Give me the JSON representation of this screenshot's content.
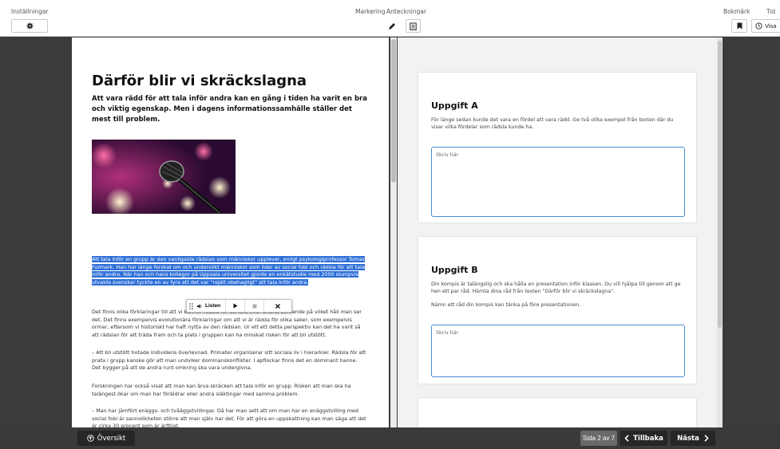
{
  "topbar": {
    "settings_label": "Inställningar",
    "markering_label": "Markering",
    "anteckningar_label": "Anteckningar",
    "bokmark_label": "Bokmärk",
    "tid_label": "Tid",
    "tid_button_label": "Visa"
  },
  "article": {
    "title": "Därför blir vi skräckslagna",
    "lead": "Att vara rädd för att tala inför andra kan en gång i tiden ha varit en bra och viktig egenskap. Men i dagens informationssamhälle ställer det mest till problem.",
    "p1": "Att tala inför en grupp är den vanligaste rädslan som människor upplever, enligt psykologiprofessor Tomas Furmark. Han har länge forskat om och undersökt människor som lider av social fobi och rädsla för att tala inför andra. När han och hans kollegor på Uppsala universitet gjorde en enkätstudie med 2000 slumpvis utvalda svenskar tyckte en av fyra att det var \"rejält obehagligt\" att tala inför andra.",
    "p2": "Det finns olika förklaringar till att vi känner rädsla för att tala inför andra, beroende på vilket håll man ser det. Det finns exempelvis evolutionära förklaringar om att vi är rädda för olika saker, som exempelvis ormar, eftersom vi historiskt har haft nytta av den rädslan. Ur ett ett detta perspektiv kan det ha varit så att rädslan för att träda fram och ta plats i gruppen kan ha minskat risken för att bli utstött.",
    "p3": "– Att bli utstött hotade individens överlevnad. Primater organiserar sitt sociala liv i hierarkier. Rädsla för att prata i grupp kanske gör att man undviker dominanskonflikter. I apflockar finns det en dominant hanne. Det bygger på att de andra runt omkring ska vara undergivna.",
    "p4": "Forskningen har också visat att man kan ärva skräcken att tala inför en grupp. Risken att man ska ha talängest ökar om man har föräldrar eller andra släktingar med samma problem.",
    "p5": "– Man har jämfört enäggs- och tvåäggstvillingar. Då har man sett att om man har en enäggstvilling med social fobi är sannolikheten större att man själv har det. För att göra en uppskattning kan man säga att det är cirka 30 procent som är ärftligt."
  },
  "listen": {
    "label": "Listen"
  },
  "tasks": [
    {
      "title": "Uppgift A",
      "text": "För länge sedan kunde det vara en fördel att vara rädd. Ge två olika exempel från texten där du visar vilka fördelar som rädsla kunde ha.",
      "placeholder": "Skriv här"
    },
    {
      "title": "Uppgift B",
      "text": "Din kompis är talängslig och ska hålla en presentation inför klassen. Du vill hjälpa till genom att ge hen ett par råd. Hämta dina råd från texten \"Därför blir vi skräckslagna\".",
      "text2": "Nämn ett råd din kompis kan tänka på före presentationen.",
      "placeholder": "Skriv här"
    }
  ],
  "bottom": {
    "overview_label": "Översikt",
    "page_indicator": "Sida 2 av 7",
    "back_label": "Tillbaka",
    "next_label": "Nästa"
  },
  "colors": {
    "highlight": "#2e6fd8",
    "input_border": "#4a8ad6",
    "dark": "#3a3a3a"
  }
}
